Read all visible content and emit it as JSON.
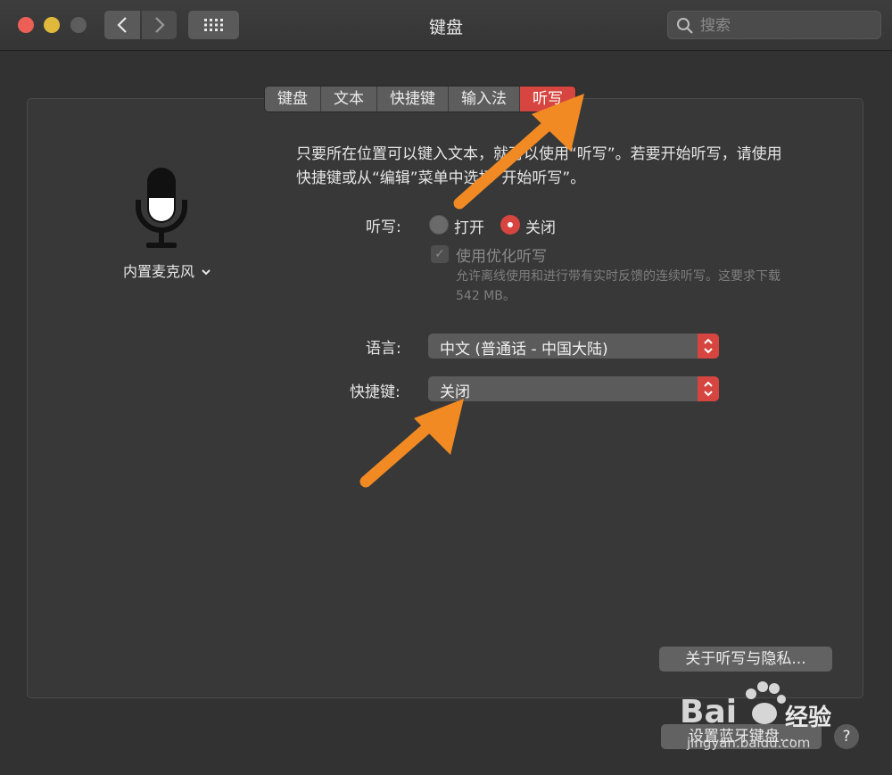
{
  "window": {
    "title": "键盘"
  },
  "search": {
    "placeholder": "搜索"
  },
  "tabs": [
    {
      "label": "键盘",
      "active": false
    },
    {
      "label": "文本",
      "active": false
    },
    {
      "label": "快捷键",
      "active": false
    },
    {
      "label": "输入法",
      "active": false
    },
    {
      "label": "听写",
      "active": true
    }
  ],
  "mic": {
    "source_label": "内置麦克风"
  },
  "dictation": {
    "description": "只要所在位置可以键入文本，就可以使用“听写”。若要开始听写，请使用快捷键或从“编辑”菜单中选择“开始听写”。",
    "label": "听写:",
    "option_on": "打开",
    "option_off": "关闭",
    "selected": "关闭",
    "enhanced_label": "使用优化听写",
    "enhanced_hint": "允许离线使用和进行带有实时反馈的连续听写。这要求下载 542 MB。",
    "language_label": "语言:",
    "language_value": "中文 (普通话 - 中国大陆)",
    "shortcut_label": "快捷键:",
    "shortcut_value": "关闭"
  },
  "buttons": {
    "about_privacy": "关于听写与隐私...",
    "bluetooth_keyboard": "设置蓝牙键盘...",
    "help": "?"
  },
  "watermark": {
    "brand": "经验",
    "url": "jingyan.baidu.com"
  },
  "colors": {
    "accent": "#d6453f",
    "annotation_arrow": "#f28a24"
  }
}
